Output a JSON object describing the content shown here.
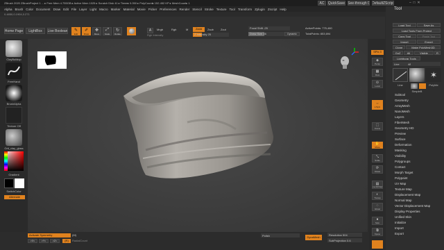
{
  "titlebar": {
    "text": "ZBrush 2020   ZBrushProject 1  ...  ▸ Free Mem 4.755GB ▸ Active Mem 1025 ▸ Scratch Disk 41 ▸ Timer▸ 0.050 ▸ PolyCount▸ 152.452 KP ▸ MeshCount▸ 1",
    "buttons": [
      "AC",
      "QuickSave",
      "See-through 0",
      "DefaultZScript"
    ]
  },
  "menubar": {
    "items": [
      "Alpha",
      "Brush",
      "Color",
      "Document",
      "Draw",
      "Edit",
      "File",
      "Layer",
      "Light",
      "Macro",
      "Marker",
      "Material",
      "Movie",
      "Picker",
      "Preferences",
      "Render",
      "Stencil",
      "Stroke",
      "Texture",
      "Tool",
      "Transform",
      "Zplugin",
      "Zscript",
      "Help"
    ]
  },
  "status_left": "0.4850,0.1904,0.271",
  "toolbar": {
    "buttons": [
      "Home Page",
      "LightBox",
      "Live Boolean"
    ],
    "icons": [
      "Edit",
      "Draw",
      "Move",
      "Scale",
      "Rotate"
    ],
    "mrgb": [
      "Mrgb",
      "Rgb",
      "M"
    ],
    "rgb_intensity": "Rgb Intensity",
    "zadd": "Zadd",
    "zsub": "Zsub",
    "zcut": "Zcut",
    "z_intensity": "Z Intensity 25",
    "focal_shift": "Focal Shift  -25",
    "draw_size": "Draw Size  46",
    "dynamic": "Dynamic",
    "active_points": "ActivePoints: 775,480",
    "total_points": "TotalPoints: 853,694"
  },
  "left_shelf": {
    "brushes": [
      "ClayBuildup",
      "FreeHand",
      "BrushAlpha"
    ],
    "texture": "Texture Off",
    "material": "Grit_clay_glass",
    "gradient": "Gradient",
    "switch_color": "SwitchColor",
    "alternate": "Alternate"
  },
  "right_shelf": {
    "labels": [
      "SPix 3",
      "Persp",
      "Floor",
      "Local",
      "L.Sym",
      "Frame",
      "Move",
      "Scale",
      "Rotate",
      "Line Fill PolyF",
      "Transp",
      "Ghost",
      "Solo",
      "Xpose"
    ]
  },
  "tool_panel": {
    "title": "Tool",
    "buttons": [
      "Load Tool",
      "Save As",
      "Load Tools From Project",
      "Copy Tool",
      "Paste Tool",
      "Import",
      "Export",
      "Clone",
      "Make PolyMesh3D",
      "GoZ",
      "All",
      "Visible",
      "R"
    ],
    "lightbox_tools": "Lightbox▸ Tools",
    "tool_name": "Line",
    "tool_value": "48",
    "thumbnails": [
      "Line",
      "SimpleB",
      "PolyMe"
    ],
    "sections": [
      "Subtool",
      "Geometry",
      "ArrayMesh",
      "NanoMesh",
      "Layers",
      "FiberMesh",
      "Geometry HD",
      "Preview",
      "Surface",
      "Deformation",
      "Masking",
      "Visibility",
      "Polygroups",
      "Contact",
      "Morph Target",
      "Polypaint",
      "UV Map",
      "Texture Map",
      "Displacement Map",
      "Normal Map",
      "Vector Displacement Map",
      "Display Properties",
      "Unified Skin",
      "Initialize",
      "Import",
      "Export"
    ]
  },
  "bottom": {
    "activate_symmetry": "Activate Symmetry",
    "sym_value": "(M)",
    "sym_buttons": [
      ">X<",
      ">Y<",
      ">Z<",
      "(R)"
    ],
    "radial_count": "RadialCount",
    "polish": "Polish",
    "dynamesh": "DynaMesh",
    "resolution": "Resolution 504",
    "subprojection": "SubProjection 0.6"
  },
  "colors": {
    "accent": "#e0821e",
    "viewport": "#3c3c3c",
    "panel": "#2b2b2b",
    "model": "#a8a49f"
  },
  "icons": {
    "head": "head-navigation-icon",
    "axis": "axis-gizmo-icon"
  }
}
